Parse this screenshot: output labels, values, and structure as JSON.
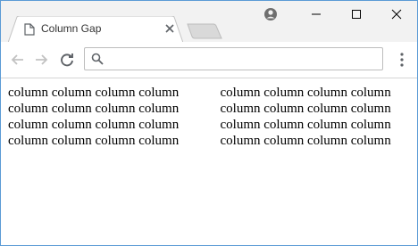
{
  "tab": {
    "title": "Column Gap"
  },
  "icons": {
    "page": "page-icon",
    "tab_close": "close-icon",
    "profile": "profile-icon",
    "minimize": "minimize-icon",
    "maximize": "maximize-icon",
    "window_close": "close-icon",
    "back": "back-arrow-icon",
    "forward": "forward-arrow-icon",
    "reload": "reload-icon",
    "search": "search-icon",
    "menu": "more-vertical-icon"
  },
  "omnibox": {
    "value": ""
  },
  "page": {
    "text": "column column column column column column column column column column column column column column column column column column column column column column column column column column column column column column column column"
  },
  "colors": {
    "window_border": "#5b9bd5",
    "tabstrip": "#f2f2f2"
  }
}
